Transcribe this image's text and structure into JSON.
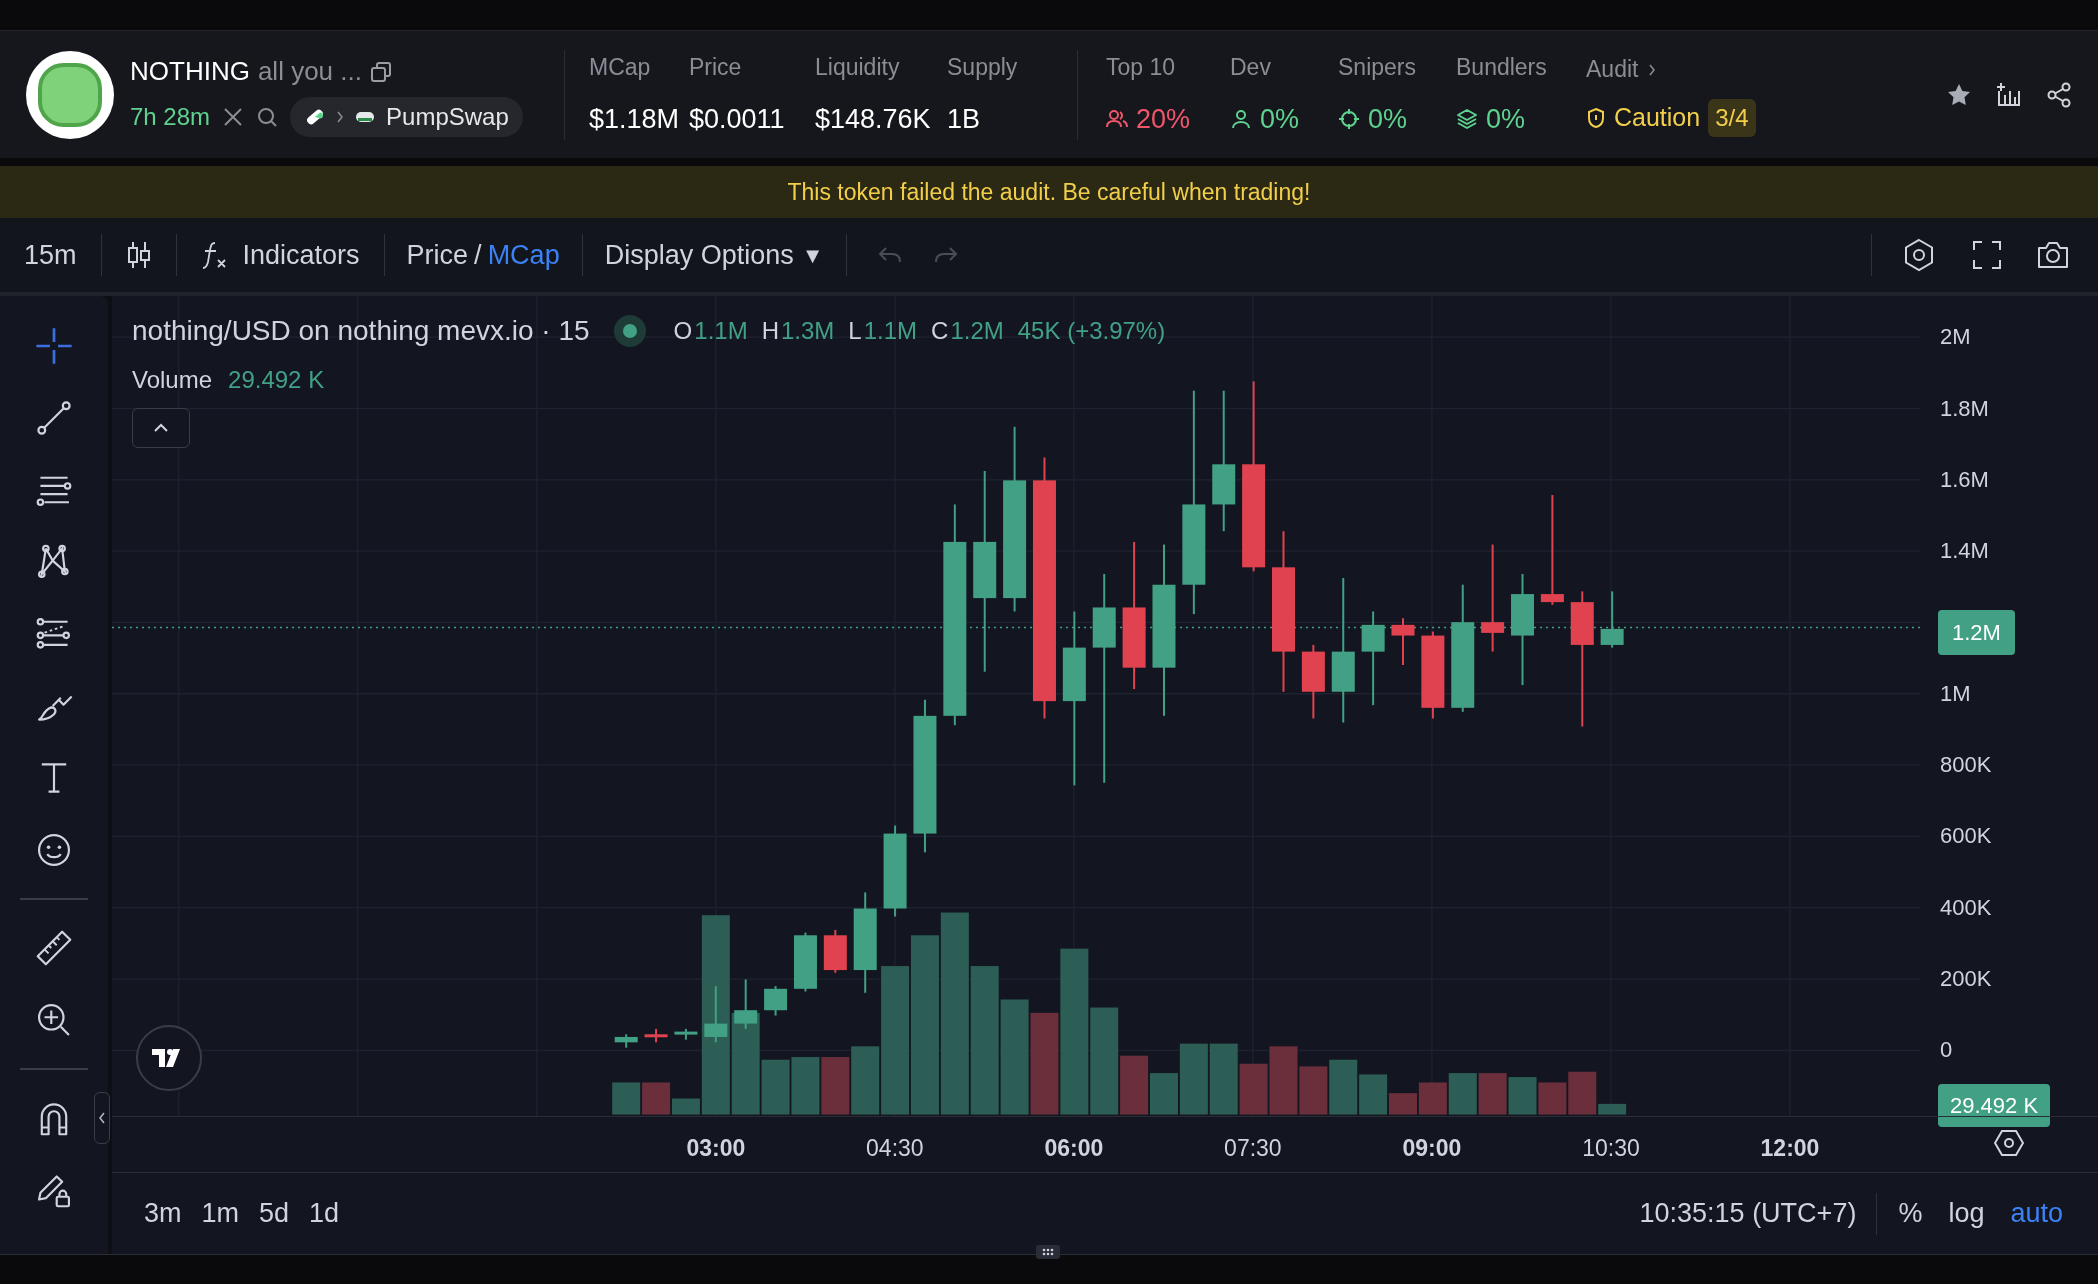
{
  "token": {
    "name": "NOTHING",
    "description": "all you ...",
    "age": "7h 28m",
    "dex": "PumpSwap"
  },
  "stats": [
    {
      "label": "MCap",
      "value": "$1.18M"
    },
    {
      "label": "Price",
      "value": "$0.0011"
    },
    {
      "label": "Liquidity",
      "value": "$148.76K"
    },
    {
      "label": "Supply",
      "value": "1B"
    }
  ],
  "holders": [
    {
      "kind": "top10",
      "label": "Top 10",
      "value": "20%",
      "color": "#f0566b"
    },
    {
      "kind": "dev",
      "label": "Dev",
      "value": "0%",
      "color": "#5ed38f"
    },
    {
      "kind": "snipers",
      "label": "Snipers",
      "value": "0%",
      "color": "#5ed38f"
    },
    {
      "kind": "bundlers",
      "label": "Bundlers",
      "value": "0%",
      "color": "#5ed38f"
    }
  ],
  "audit": {
    "label": "Audit",
    "status": "Caution",
    "score": "3/4"
  },
  "banner": "This token failed the audit. Be careful when trading!",
  "toolbar": {
    "interval": "15m",
    "indicators": "Indicators",
    "price_modes": [
      {
        "label": "Price",
        "selected": false
      },
      {
        "label": "MCap",
        "selected": true
      }
    ],
    "separator": "/",
    "display_options": "Display Options",
    "dropdown_arrow": "▼",
    "history": [
      {
        "kind": "undo",
        "disabled": true
      },
      {
        "kind": "redo",
        "disabled": true
      }
    ]
  },
  "tools": [
    {
      "kind": "crosshair",
      "selected": true
    },
    {
      "kind": "trendline",
      "selected": false
    },
    {
      "kind": "fib",
      "selected": false
    },
    {
      "kind": "pattern",
      "selected": false
    },
    {
      "kind": "projection",
      "selected": false
    },
    {
      "kind": "brush",
      "selected": false
    },
    {
      "kind": "text",
      "selected": false
    },
    {
      "kind": "emoji",
      "selected": false
    },
    {
      "kind": "separator"
    },
    {
      "kind": "ruler",
      "selected": false
    },
    {
      "kind": "zoom",
      "selected": false
    },
    {
      "kind": "separator"
    },
    {
      "kind": "magnet",
      "selected": false
    },
    {
      "kind": "lock",
      "selected": false
    }
  ],
  "chart": {
    "title": "nothing/USD on nothing mevx.io · 15",
    "ohlc": [
      {
        "label": "O",
        "value": "1.1M"
      },
      {
        "label": "H",
        "value": "1.3M"
      },
      {
        "label": "L",
        "value": "1.1M"
      },
      {
        "label": "C",
        "value": "1.2M"
      }
    ],
    "change": "45K (+3.97%)",
    "volume_label": "Volume",
    "volume_value": "29.492 K",
    "y_ticks": [
      "2M",
      "1.8M",
      "1.6M",
      "1.4M",
      "1M",
      "800K",
      "600K",
      "400K",
      "200K",
      "0"
    ],
    "price_badge": "1.2M",
    "volume_badge": "29.492 K",
    "x_ticks": [
      {
        "label": "03:00",
        "major": true
      },
      {
        "label": "04:30",
        "major": false
      },
      {
        "label": "06:00",
        "major": true
      },
      {
        "label": "07:30",
        "major": false
      },
      {
        "label": "09:00",
        "major": true
      },
      {
        "label": "10:30",
        "major": false
      },
      {
        "label": "12:00",
        "major": true
      }
    ]
  },
  "footer": {
    "ranges": [
      "3m",
      "1m",
      "5d",
      "1d"
    ],
    "clock": "10:35:15 (UTC+7)",
    "scales": [
      {
        "label": "%",
        "selected": false
      },
      {
        "label": "log",
        "selected": false
      },
      {
        "label": "auto",
        "selected": true
      }
    ]
  }
}
